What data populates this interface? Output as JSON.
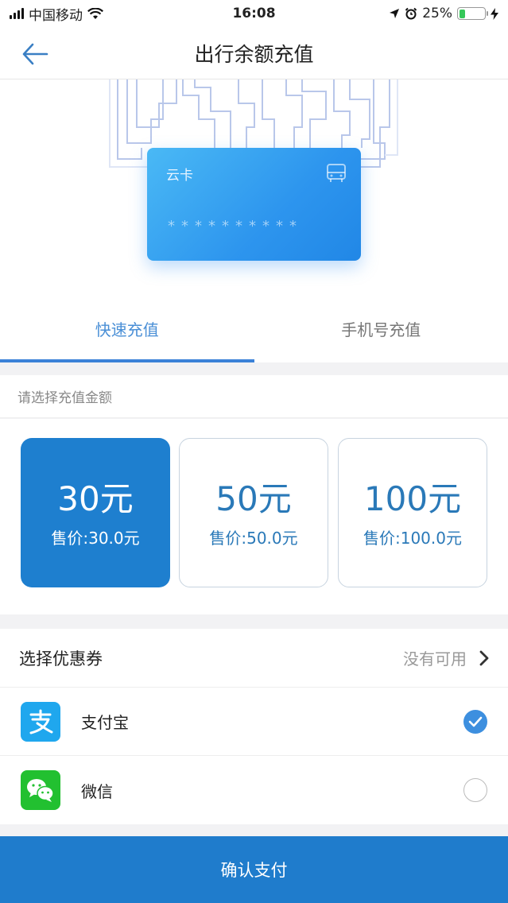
{
  "status_bar": {
    "carrier": "中国移动",
    "time": "16:08",
    "battery": "25%",
    "battery_level": 0.25
  },
  "nav": {
    "title": "出行余额充值"
  },
  "card": {
    "name": "云卡",
    "number_mask": "**********"
  },
  "tabs": [
    {
      "label": "快速充值",
      "active": true
    },
    {
      "label": "手机号充值",
      "active": false
    }
  ],
  "amount": {
    "header": "请选择充值金额",
    "options": [
      {
        "value": "30元",
        "price": "售价:30.0元",
        "selected": true
      },
      {
        "value": "50元",
        "price": "售价:50.0元",
        "selected": false
      },
      {
        "value": "100元",
        "price": "售价:100.0元",
        "selected": false
      }
    ]
  },
  "coupon": {
    "label": "选择优惠券",
    "value": "没有可用"
  },
  "payment": {
    "methods": [
      {
        "name": "支付宝",
        "checked": true
      },
      {
        "name": "微信",
        "checked": false
      }
    ]
  },
  "confirm": {
    "label": "确认支付"
  },
  "colors": {
    "accent": "#1e7fcf",
    "tab_active": "#4a8fd6",
    "alipay": "#1fa7ee",
    "wechat": "#22c030"
  }
}
